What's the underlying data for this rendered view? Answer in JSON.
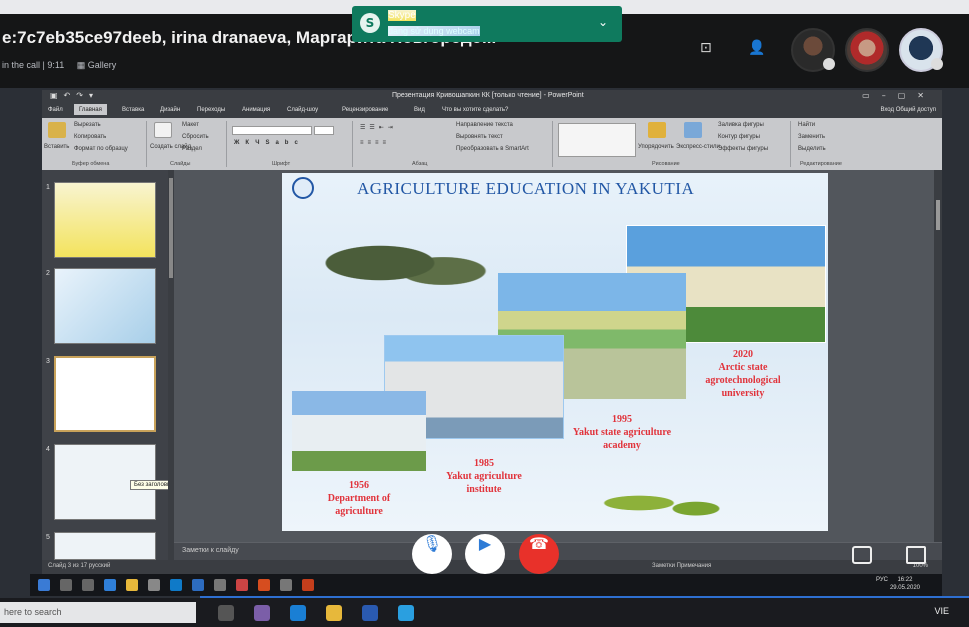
{
  "skype": {
    "call_title": "e:7c7eb35ce97deeb, irina dranaeva, Маргарита Новгородо...",
    "in_call": "in the call | 9:11",
    "gallery_label": "Gallery",
    "toast_app": "Skype",
    "toast_message": "đang sử dụng webcam",
    "controls": {
      "mic_icon": "microphone-icon",
      "camera_icon": "camera-icon",
      "hangup_icon": "hangup-icon",
      "chat_icon": "chat-icon",
      "screens_icon": "share-screen-icon"
    }
  },
  "powerpoint": {
    "window_title": "Презентация Кривошапкин КК [только чтение] - PowerPoint",
    "tabs": [
      "Файл",
      "Главная",
      "Вставка",
      "Дизайн",
      "Переходы",
      "Анимация",
      "Слайд-шоу",
      "Рецензирование",
      "Вид",
      "Что вы хотите сделать?"
    ],
    "active_tab_index": 1,
    "tab_right": [
      "Вход",
      "Общий доступ"
    ],
    "ribbon": {
      "paste": "Вставить",
      "cut": "Вырезать",
      "copy": "Копировать",
      "format_painter": "Формат по образцу",
      "clipboard_group": "Буфер обмена",
      "new_slide": "Создать слайд",
      "layout": "Макет",
      "reset": "Сбросить",
      "section": "Раздел",
      "slides_group": "Слайды",
      "font_group": "Шрифт",
      "paragraph_group": "Абзац",
      "text_direction": "Направление текста",
      "align_text": "Выровнять текст",
      "smartart": "Преобразовать в SmartArt",
      "arrange": "Упорядочить",
      "quick_styles": "Экспресс-стили",
      "shape_fill": "Заливка фигуры",
      "shape_outline": "Контур фигуры",
      "shape_effects": "Эффекты фигуры",
      "drawing_group": "Рисование",
      "find": "Найти",
      "replace": "Заменить",
      "select": "Выделить",
      "editing_group": "Редактирование"
    },
    "thumbnail_numbers": [
      "1",
      "2",
      "3",
      "4",
      "5"
    ],
    "tooltip": "Без заголовка",
    "notes_placeholder": "Заметки к слайду",
    "status_left": "Слайд 3 из 17    русский",
    "status_notes": "Заметки",
    "status_comments": "Примечания",
    "zoom": "100%"
  },
  "slide": {
    "title": "AGRICULTURE EDUCATION IN YAKUTIA",
    "captions": {
      "c2020": "2020\nArctic state\nagrotechnological\nuniversity",
      "c1995": "1995\nYakut state agriculture\nacademy",
      "c1985": "1985\nYakut agriculture\ninstitute",
      "c1956": "1956\nDepartment of\nagriculture"
    },
    "caption_color": "#e1333b",
    "title_color": "#2257a5"
  },
  "remote_taskbar": {
    "tray_text": "РУС",
    "time": "16:22",
    "date": "29.05.2020"
  },
  "local_taskbar": {
    "search_placeholder": "here to search",
    "tray_text": "VIE"
  }
}
